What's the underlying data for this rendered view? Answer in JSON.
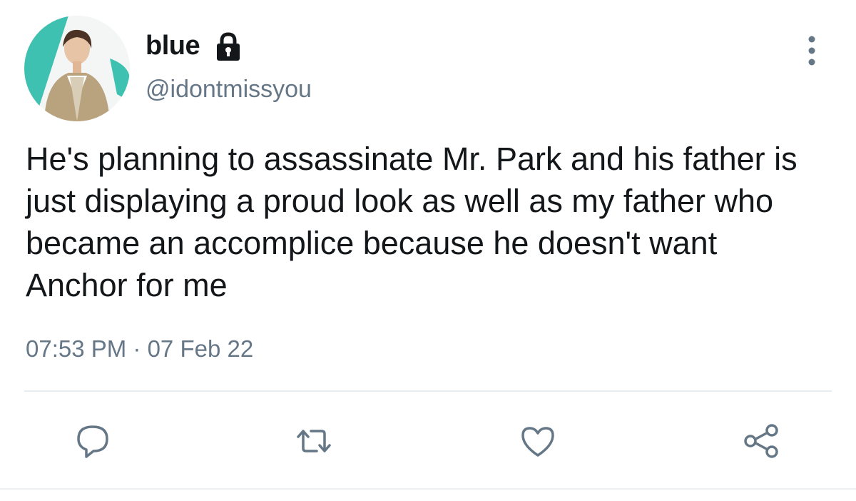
{
  "user": {
    "display_name": "blue",
    "handle": "@idontmissyou",
    "protected_icon": "lock-icon",
    "avatar_icon": "profile-avatar"
  },
  "tweet": {
    "text": "He's planning to assassinate Mr. Park and his father is just displaying a proud look as well as my father who became an accomplice because he doesn't want Anchor for me",
    "timestamp": "07:53 PM · 07 Feb 22"
  },
  "actions": [
    {
      "name": "reply",
      "icon": "comment-icon"
    },
    {
      "name": "retweet",
      "icon": "retweet-icon"
    },
    {
      "name": "like",
      "icon": "heart-icon"
    },
    {
      "name": "share",
      "icon": "share-icon"
    }
  ],
  "colors": {
    "text_primary": "#14171a",
    "text_secondary": "#657786",
    "icon": "#657786",
    "divider": "#e6ecf0",
    "avatar_accent": "#3fc1b1"
  }
}
